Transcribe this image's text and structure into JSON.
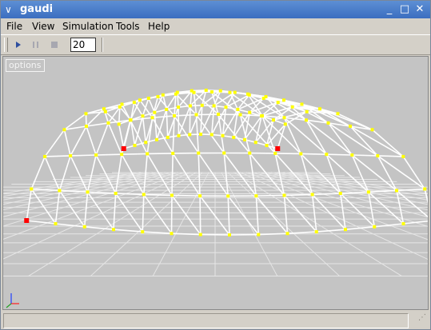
{
  "window": {
    "title": "gaudi",
    "menu_glyph": "∨",
    "minimize_glyph": "_",
    "maximize_glyph": "□",
    "close_glyph": "✕"
  },
  "menu": [
    {
      "label": "File"
    },
    {
      "label": "View"
    },
    {
      "label": "Simulation"
    },
    {
      "label": "Tools"
    },
    {
      "label": "Help"
    }
  ],
  "toolbar": {
    "play_icon": "play-icon",
    "pause_icon": "pause-icon",
    "stop_icon": "stop-icon",
    "steps_value": "20"
  },
  "viewport": {
    "options_label": "options",
    "colors": {
      "background": "#c4c4c4",
      "grid": "#e6e6e6",
      "structure": "#ffffff",
      "node": "#ffff00",
      "anchor": "#ff0000"
    },
    "axes_icon": "xyz-axes-icon"
  },
  "status": {
    "text": ""
  }
}
